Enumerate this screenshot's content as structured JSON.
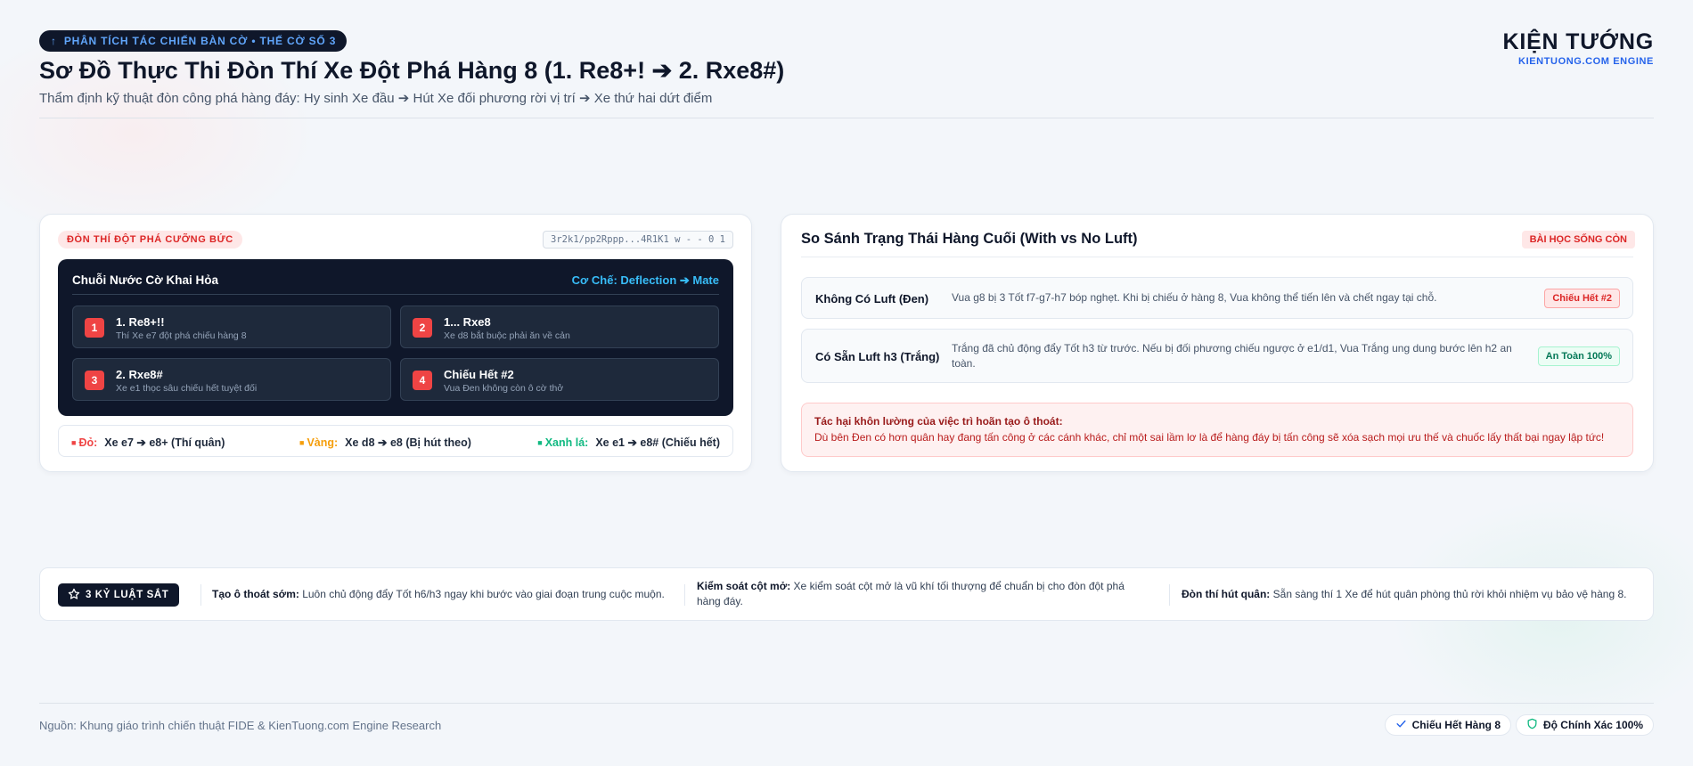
{
  "header": {
    "badge": "PHÂN TÍCH TÁC CHIẾN BÀN CỜ • THẾ CỜ SỐ 3",
    "title": "Sơ Đồ Thực Thi Đòn Thí Xe Đột Phá Hàng 8 (1. Re8+! ➔ 2. Rxe8#)",
    "subtitle": "Thẩm định kỹ thuật đòn công phá hàng đáy: Hy sinh Xe đầu ➔ Hút Xe đối phương rời vị trí ➔ Xe thứ hai dứt điểm"
  },
  "brand": {
    "name": "KIỆN TƯỚNG",
    "sub": "KIENTUONG.COM ENGINE"
  },
  "left_card": {
    "tag": "ĐÒN THÍ ĐỘT PHÁ CƯỠNG BỨC",
    "fen": "3r2k1/pp2Rppp...4R1K1 w - - 0 1",
    "panel_title": "Chuỗi Nước Cờ Khai Hỏa",
    "mechanism": "Cơ Chế: Deflection ➔ Mate",
    "moves": [
      {
        "num": "1",
        "title": "1. Re8+!!",
        "desc": "Thí Xe e7 đột phá chiếu hàng 8"
      },
      {
        "num": "2",
        "title": "1... Rxe8",
        "desc": "Xe d8 bắt buộc phải ăn về cản"
      },
      {
        "num": "3",
        "title": "2. Rxe8#",
        "desc": "Xe e1 thọc sâu chiếu hết tuyệt đối"
      },
      {
        "num": "4",
        "title": "Chiếu Hết #2",
        "desc": "Vua Đen không còn ô cờ thở"
      }
    ],
    "legend": [
      {
        "icon": "■",
        "label": "Đỏ:",
        "value": "Xe e7 ➔ e8+ (Thí quân)",
        "color": "#ef4444"
      },
      {
        "icon": "■",
        "label": "Vàng:",
        "value": "Xe d8 ➔ e8 (Bị hút theo)",
        "color": "#f59e0b"
      },
      {
        "icon": "■",
        "label": "Xanh lá:",
        "value": "Xe e1 ➔ e8# (Chiếu hết)",
        "color": "#10b981"
      }
    ]
  },
  "right_card": {
    "title": "So Sánh Trạng Thái Hàng Cuối (With vs No Luft)",
    "tag": "BÀI HỌC SỐNG CÒN",
    "rows": [
      {
        "label": "Không Có Luft (Đen)",
        "desc": "Vua g8 bị 3 Tốt f7-g7-h7 bóp nghẹt. Khi bị chiếu ở hàng 8, Vua không thể tiến lên và chết ngay tại chỗ.",
        "tag": "Chiếu Hết #2"
      },
      {
        "label": "Có Sẵn Luft h3 (Trắng)",
        "desc": "Trắng đã chủ động đẩy Tốt h3 từ trước. Nếu bị đối phương chiếu ngược ở e1/d1, Vua Trắng ung dung bước lên h2 an toàn.",
        "tag": "An Toàn 100%"
      }
    ],
    "warning_title": "Tác hại khôn lường của việc trì hoãn tạo ô thoát:",
    "warning_desc": "Dù bên Đen có hơn quân hay đang tấn công ở các cánh khác, chỉ một sai lầm lơ là để hàng đáy bị tấn công sẽ xóa sạch mọi ưu thế và chuốc lấy thất bại ngay lập tức!"
  },
  "rules": {
    "badge": "3 KỶ LUẬT SẮT",
    "items": [
      {
        "title": "Tạo ô thoát sớm:",
        "text": " Luôn chủ động đẩy Tốt h6/h3 ngay khi bước vào giai đoạn trung cuộc muộn."
      },
      {
        "title": "Kiểm soát cột mở:",
        "text": " Xe kiểm soát cột mở là vũ khí tối thượng để chuẩn bị cho đòn đột phá hàng đáy."
      },
      {
        "title": "Đòn thí hút quân:",
        "text": " Sẵn sàng thí 1 Xe để hút quân phòng thủ rời khỏi nhiệm vụ bảo vệ hàng 8."
      }
    ]
  },
  "footer": {
    "source": "Nguồn: Khung giáo trình chiến thuật FIDE & KienTuong.com Engine Research",
    "badge1": "Chiếu Hết Hàng 8",
    "badge2": "Độ Chính Xác 100%"
  },
  "icons": {
    "badge_icon": "arrow-up-icon",
    "rules_icon": "star-icon",
    "footer_badge1_icon": "check-icon",
    "footer_badge2_icon": "shield-icon"
  },
  "colors": {
    "navy": "#0f172a",
    "accent_blue": "#60a5fa",
    "danger": "#ef4444",
    "warning": "#f59e0b",
    "success": "#10b981"
  }
}
